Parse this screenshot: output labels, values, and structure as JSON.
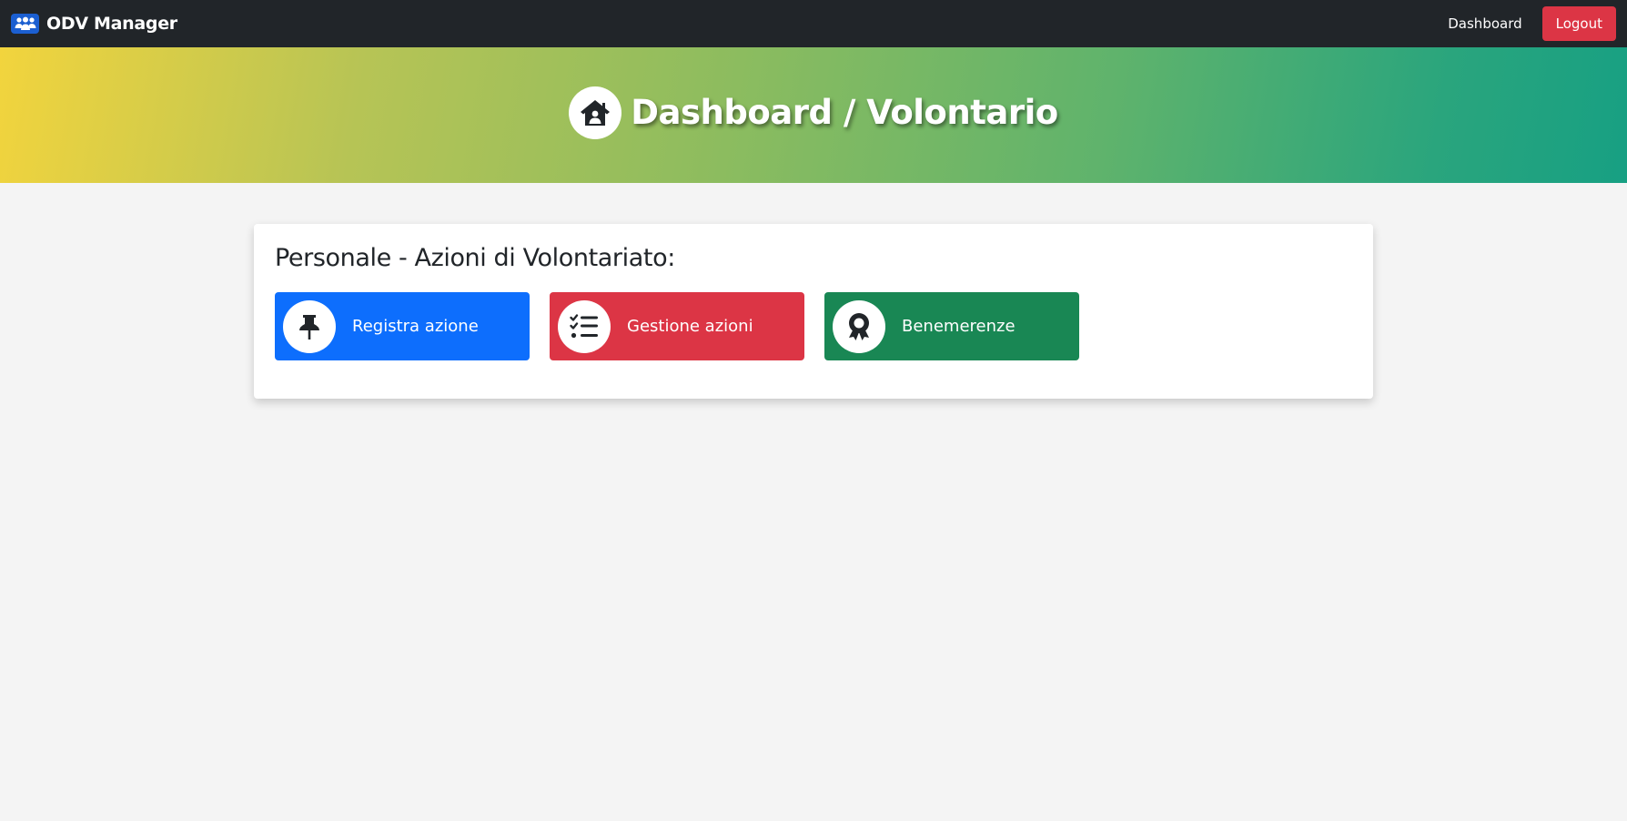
{
  "navbar": {
    "brand": "ODV Manager",
    "brand_icon": "users-icon",
    "links": {
      "dashboard": "Dashboard"
    },
    "logout_label": "Logout"
  },
  "hero": {
    "title": "Dashboard / Volontario",
    "icon": "house-user-icon"
  },
  "card": {
    "title": "Personale - Azioni di Volontariato:",
    "actions": [
      {
        "label": "Registra azione",
        "icon": "thumbtack-icon",
        "color": "#0d6efd"
      },
      {
        "label": "Gestione azioni",
        "icon": "list-check-icon",
        "color": "#dc3545"
      },
      {
        "label": "Benemerenze",
        "icon": "award-icon",
        "color": "#198754"
      }
    ]
  },
  "colors": {
    "navbar_bg": "#212529",
    "page_bg": "#f4f4f4",
    "danger": "#dc3545",
    "primary": "#0d6efd",
    "success": "#198754"
  }
}
